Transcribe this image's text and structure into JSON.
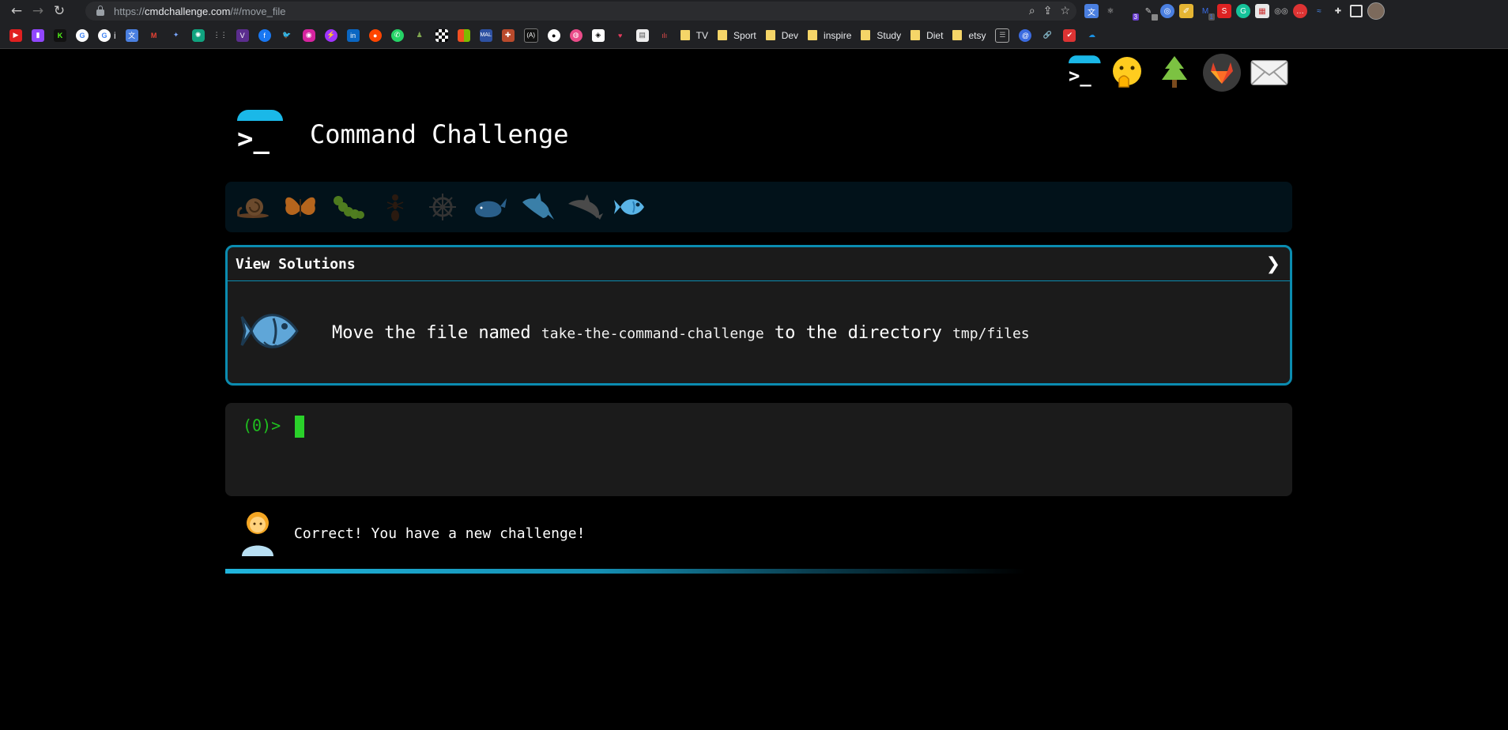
{
  "browser": {
    "url_prefix": "https://",
    "url_host": "cmdchallenge.com",
    "url_path": "/#/move_file",
    "ext_badge_1": "3",
    "ext_badge_2": "1"
  },
  "bookmarks": {
    "folders": [
      "TV",
      "Sport",
      "Dev",
      "inspire",
      "Study",
      "Diet",
      "etsy"
    ],
    "short_label": "i"
  },
  "page": {
    "title": "Command Challenge",
    "top_links": [
      "cmdchallenge-logo-icon",
      "face-with-hand-over-mouth-icon",
      "evergreen-tree-icon",
      "gitlab-icon",
      "envelope-icon"
    ],
    "levels": [
      "snail",
      "butterfly",
      "caterpillar",
      "ant",
      "helm-wheel",
      "whale",
      "shark",
      "dolphin",
      "fish"
    ],
    "active_level": "fish",
    "solutions_label": "View Solutions",
    "chevron": "❯",
    "task": {
      "prefix": "Move the file named ",
      "filename": "take-the-command-challenge",
      "middle": " to the directory ",
      "dir": "tmp/files"
    },
    "prompt": "(0)> ",
    "feedback": "Correct! You have a new challenge!",
    "colors": {
      "accent": "#1ab8e8",
      "card_border": "#0b8cb0",
      "prompt": "#1fbf1f"
    }
  }
}
